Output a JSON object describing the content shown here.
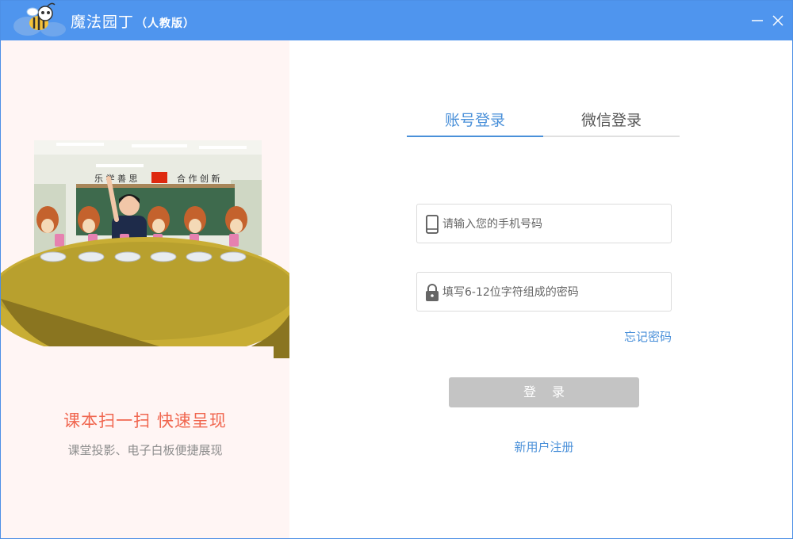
{
  "titlebar": {
    "app_name": "魔法园丁",
    "edition": "（人教版）",
    "minimize_icon": "minimize-icon",
    "close_icon": "close-icon"
  },
  "promo": {
    "scene_banner_left": "乐 学 善 思",
    "scene_banner_right": "合 作 创 新",
    "headline": "课本扫一扫 快速呈现",
    "subline": "课堂投影、电子白板便捷展现"
  },
  "login": {
    "tabs": [
      {
        "label": "账号登录",
        "active": true
      },
      {
        "label": "微信登录",
        "active": false
      }
    ],
    "phone": {
      "placeholder": "请输入您的手机号码",
      "value": "",
      "icon": "mobile-phone-icon"
    },
    "password": {
      "placeholder": "填写6-12位字符组成的密码",
      "value": "",
      "icon": "lock-icon"
    },
    "forgot_label": "忘记密码",
    "submit_label": "登录",
    "register_label": "新用户注册"
  },
  "colors": {
    "titlebar": "#4f95ee",
    "accent": "#4a90d9",
    "promo_title": "#f0664f",
    "promo_bg": "#fff5f4",
    "button_disabled": "#c4c4c4"
  }
}
